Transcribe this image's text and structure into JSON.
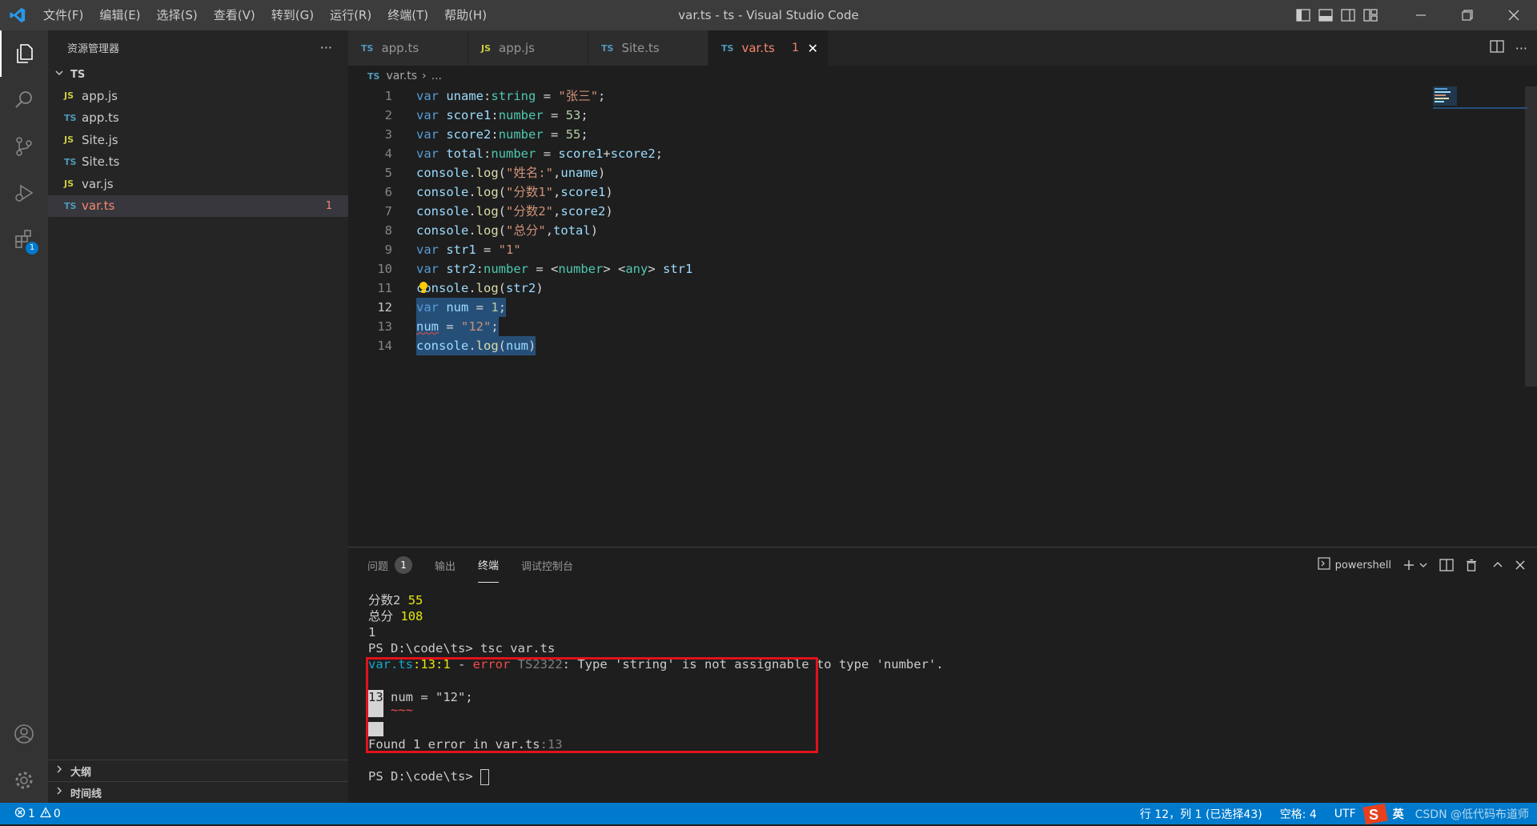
{
  "window": {
    "title": "var.ts - ts - Visual Studio Code"
  },
  "menu": [
    "文件(F)",
    "编辑(E)",
    "选择(S)",
    "查看(V)",
    "转到(G)",
    "运行(R)",
    "终端(T)",
    "帮助(H)"
  ],
  "activity": {
    "extensions_badge": "1"
  },
  "sidebar": {
    "title": "资源管理器",
    "more": "···",
    "section": "TS",
    "files": [
      {
        "icon": "JS",
        "name": "app.js"
      },
      {
        "icon": "TS",
        "name": "app.ts"
      },
      {
        "icon": "JS",
        "name": "Site.js"
      },
      {
        "icon": "TS",
        "name": "Site.ts"
      },
      {
        "icon": "JS",
        "name": "var.js"
      },
      {
        "icon": "TS",
        "name": "var.ts",
        "errors": "1"
      }
    ],
    "outline": "大纲",
    "timeline": "时间线"
  },
  "tabs": [
    {
      "icon": "TS",
      "label": "app.ts"
    },
    {
      "icon": "JS",
      "label": "app.js"
    },
    {
      "icon": "TS",
      "label": "Site.ts"
    },
    {
      "icon": "TS",
      "label": "var.ts",
      "errors": "1",
      "close": "✕"
    }
  ],
  "breadcrumb": {
    "icon": "TS",
    "file": "var.ts",
    "sep": "›",
    "rest": "..."
  },
  "editor": {
    "line_numbers": [
      "1",
      "2",
      "3",
      "4",
      "5",
      "6",
      "7",
      "8",
      "9",
      "10",
      "11",
      "12",
      "13",
      "14"
    ]
  },
  "panel": {
    "tabs": [
      {
        "label": "问题",
        "badge": "1"
      },
      {
        "label": "输出"
      },
      {
        "label": "终端"
      },
      {
        "label": "调试控制台"
      }
    ],
    "shell": "powershell",
    "terminal": {
      "l1": {
        "label": "分数2",
        "value": "55"
      },
      "l2": {
        "label": "总分",
        "value": "108"
      },
      "l3": "1",
      "l4": "PS D:\\code\\ts> tsc var.ts",
      "err": {
        "file": "var.ts",
        "pos": ":13:1",
        "dash": " - ",
        "kind": "error",
        "code": " TS2322",
        "msg": ": Type 'string' is not assignable to type 'number'."
      },
      "ctx_ln": "13",
      "ctx_code": " num = \"12\";",
      "ctx_squig": "~~~",
      "found": "Found 1 error in var.ts",
      "found_pos": ":13",
      "prompt": "PS D:\\code\\ts> "
    }
  },
  "status": {
    "errors": "1",
    "warnings": "0",
    "position": "行 12，列 1 (已选择43)",
    "spaces": "空格: 4",
    "encoding": "UTF",
    "ime": "英",
    "watermark": "CSDN @低代码布道师"
  },
  "colors": {
    "accent": "#007acc",
    "error": "#f14c4c",
    "error_box": "#e0131b"
  }
}
